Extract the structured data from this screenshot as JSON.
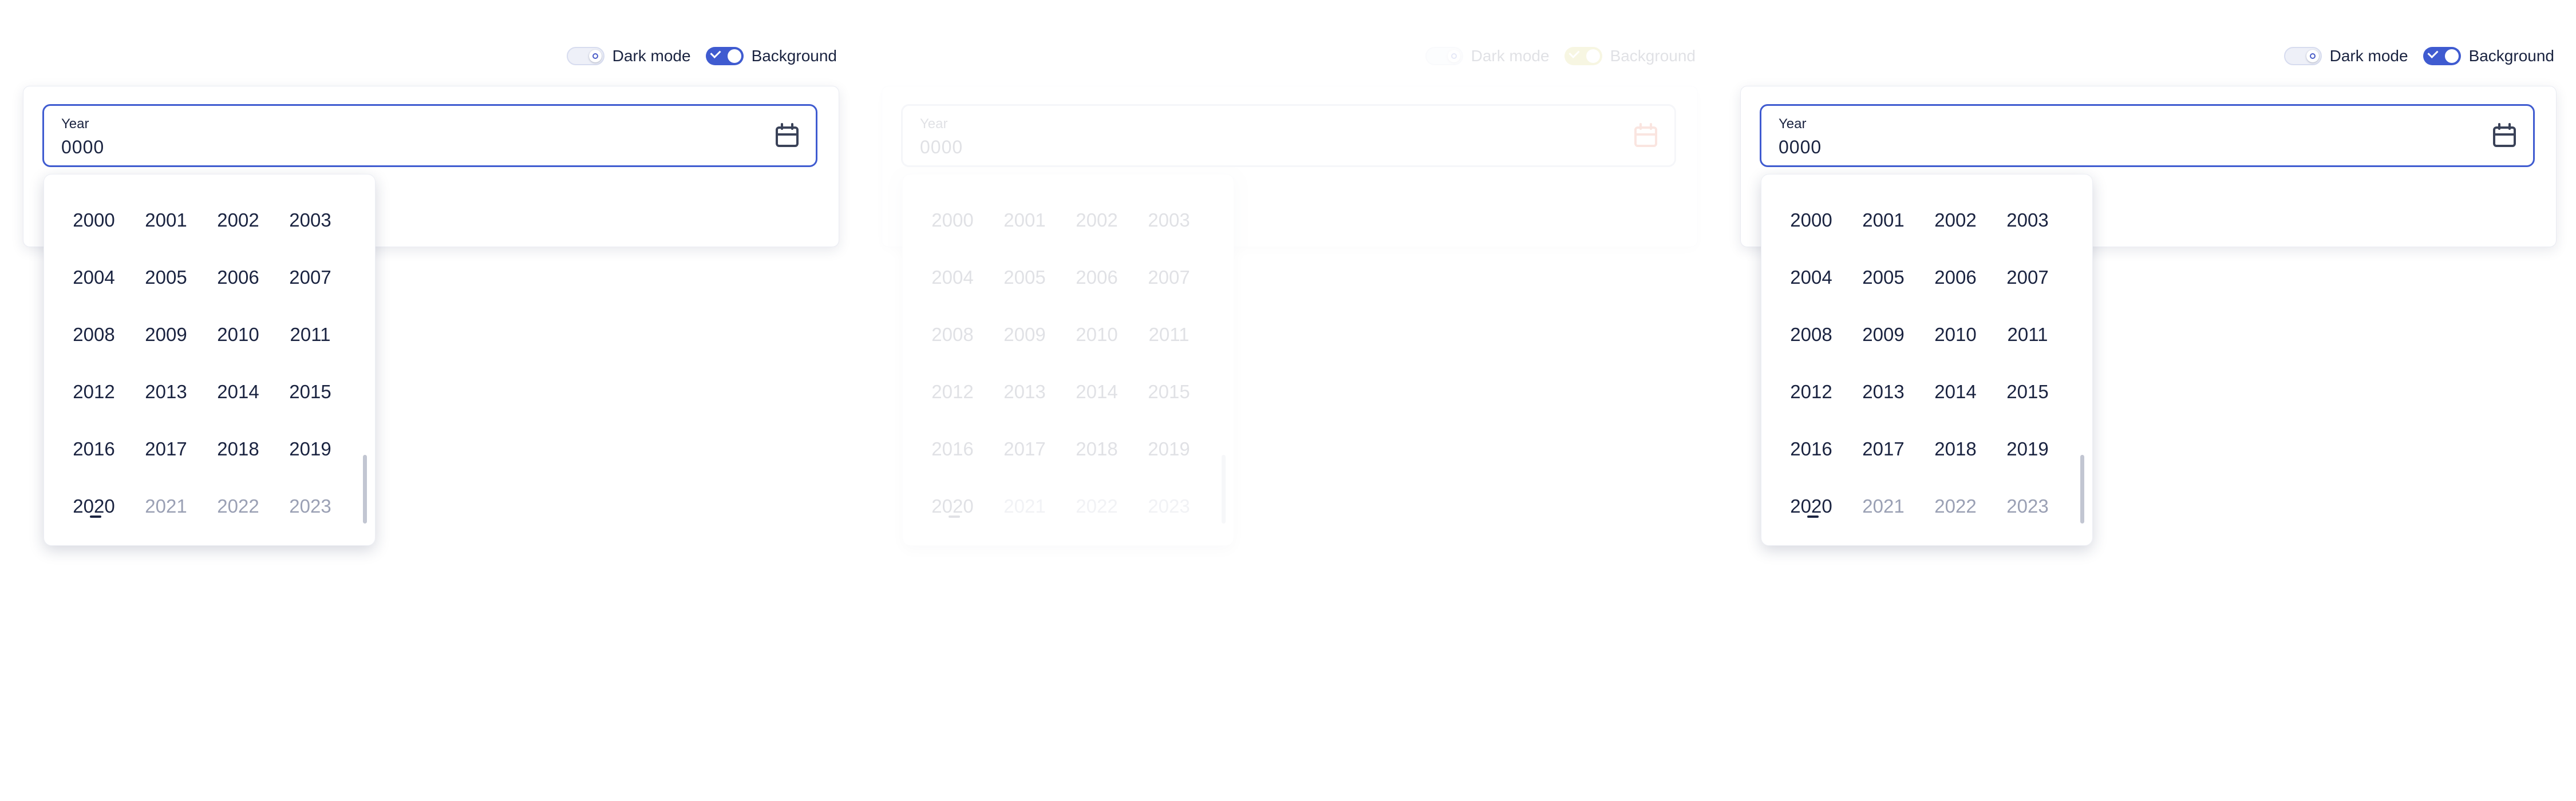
{
  "toggles": {
    "dark_mode_label": "Dark mode",
    "background_label": "Background"
  },
  "year_field": {
    "label": "Year",
    "value": "0000",
    "icon": "calendar-icon"
  },
  "years": [
    {
      "label": "2000",
      "state": "normal"
    },
    {
      "label": "2001",
      "state": "normal"
    },
    {
      "label": "2002",
      "state": "normal"
    },
    {
      "label": "2003",
      "state": "normal"
    },
    {
      "label": "2004",
      "state": "normal"
    },
    {
      "label": "2005",
      "state": "normal"
    },
    {
      "label": "2006",
      "state": "normal"
    },
    {
      "label": "2007",
      "state": "normal"
    },
    {
      "label": "2008",
      "state": "normal"
    },
    {
      "label": "2009",
      "state": "normal"
    },
    {
      "label": "2010",
      "state": "normal"
    },
    {
      "label": "2011",
      "state": "normal"
    },
    {
      "label": "2012",
      "state": "normal"
    },
    {
      "label": "2013",
      "state": "normal"
    },
    {
      "label": "2014",
      "state": "normal"
    },
    {
      "label": "2015",
      "state": "normal"
    },
    {
      "label": "2016",
      "state": "normal"
    },
    {
      "label": "2017",
      "state": "normal"
    },
    {
      "label": "2018",
      "state": "normal"
    },
    {
      "label": "2019",
      "state": "normal"
    },
    {
      "label": "2020",
      "state": "current"
    },
    {
      "label": "2021",
      "state": "disabled"
    },
    {
      "label": "2022",
      "state": "disabled"
    },
    {
      "label": "2023",
      "state": "disabled"
    }
  ],
  "colors": {
    "accent": "#3f5bd0",
    "text": "#1a2340",
    "muted": "#9aa0b4",
    "faded_toggle": "#c8bd2a",
    "faded_icon": "#e0401a"
  }
}
